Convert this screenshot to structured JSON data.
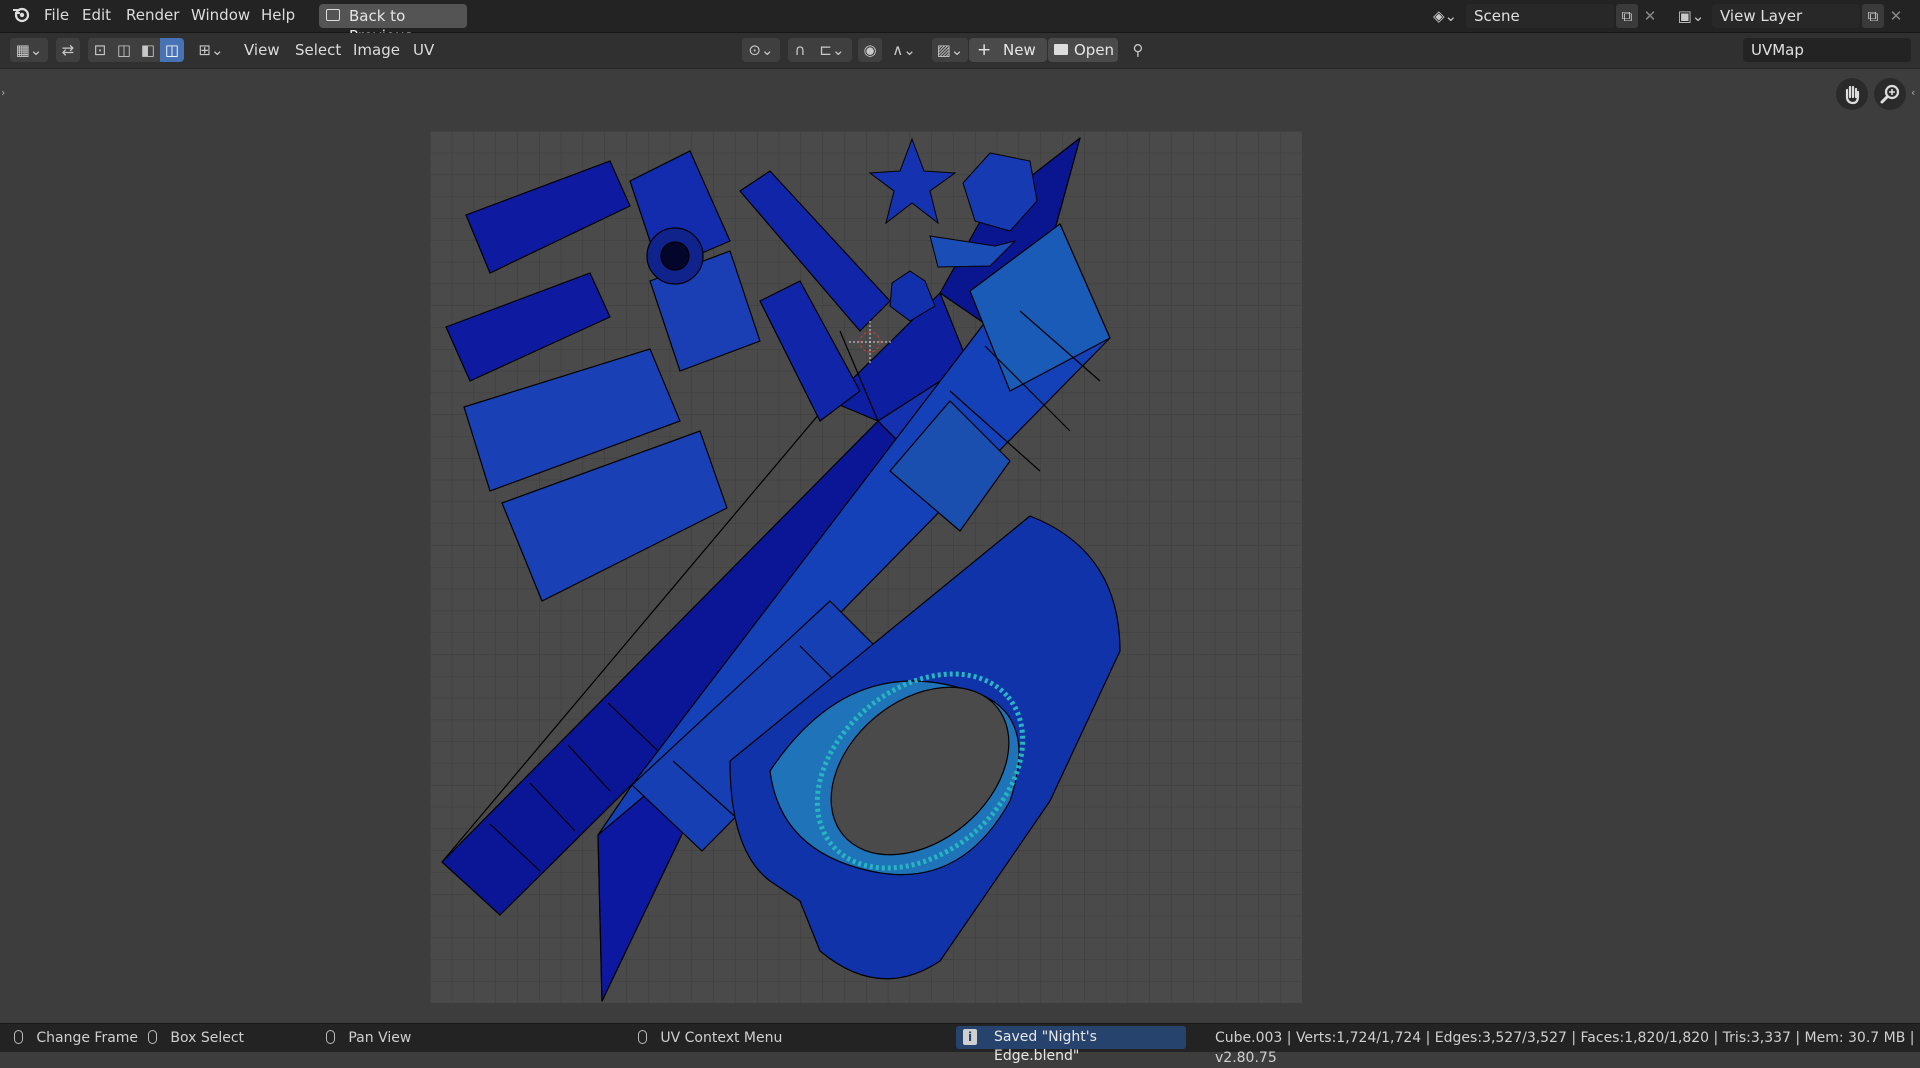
{
  "topbar": {
    "menus": [
      "File",
      "Edit",
      "Render",
      "Window",
      "Help"
    ],
    "back_button": "Back to Previous",
    "scene_label": "Scene",
    "view_layer_label": "View Layer"
  },
  "editor_header": {
    "menus": [
      "View",
      "Select",
      "Image",
      "UV"
    ],
    "new_label": "New",
    "open_label": "Open",
    "uvmap_label": "UVMap"
  },
  "statusbar": {
    "change_frame": "Change Frame",
    "box_select": "Box Select",
    "pan_view": "Pan View",
    "uv_context_menu": "UV Context Menu",
    "saved_message": "Saved \"Night's Edge.blend\"",
    "stats": "Cube.003 | Verts:1,724/1,724 | Edges:3,527/3,527 | Faces:1,820/1,820 | Tris:3,337 | Mem: 30.7 MB | v2.80.75"
  },
  "icons": {
    "blender_logo": "blender-logo-icon",
    "hand": "hand-icon",
    "zoom": "zoom-icon",
    "pin": "pin-icon"
  },
  "colors": {
    "uv_face_dark": "#0a1aa0",
    "uv_face_light": "#1a5fb4",
    "uv_edge": "#000000",
    "grid_bg": "#4a4a4a"
  }
}
